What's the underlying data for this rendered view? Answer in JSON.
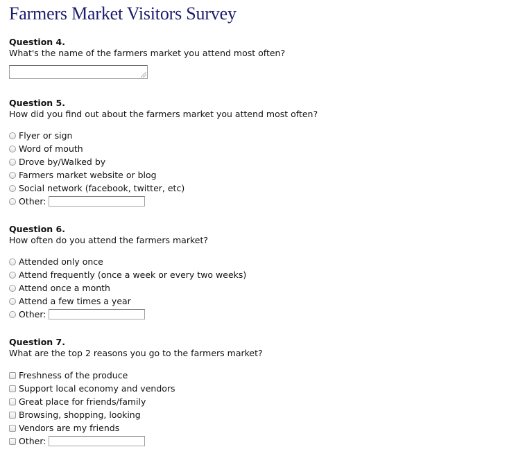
{
  "page_title": "Farmers Market Visitors Survey",
  "q4": {
    "number": "Question 4.",
    "text": "What's the name of the farmers market you attend most often?",
    "answer_value": ""
  },
  "q5": {
    "number": "Question 5.",
    "text": "How did you find out about the farmers market you attend most often?",
    "options": [
      "Flyer or sign",
      "Word of mouth",
      "Drove by/Walked by",
      "Farmers market website or blog",
      "Social network (facebook, twitter, etc)",
      "Other:"
    ],
    "other_value": ""
  },
  "q6": {
    "number": "Question 6.",
    "text": "How often do you attend the farmers market?",
    "options": [
      "Attended only once",
      "Attend frequently (once a week or every two weeks)",
      "Attend once a month",
      "Attend a few times a year",
      "Other:"
    ],
    "other_value": ""
  },
  "q7": {
    "number": "Question 7.",
    "text": "What are the top 2 reasons you go to the farmers market?",
    "options": [
      "Freshness of the produce",
      "Support local economy and vendors",
      "Great place for friends/family",
      "Browsing, shopping, looking",
      "Vendors are my friends",
      "Other:"
    ],
    "other_value": ""
  },
  "colors": {
    "title": "#1c1c6e",
    "text": "#111111"
  }
}
